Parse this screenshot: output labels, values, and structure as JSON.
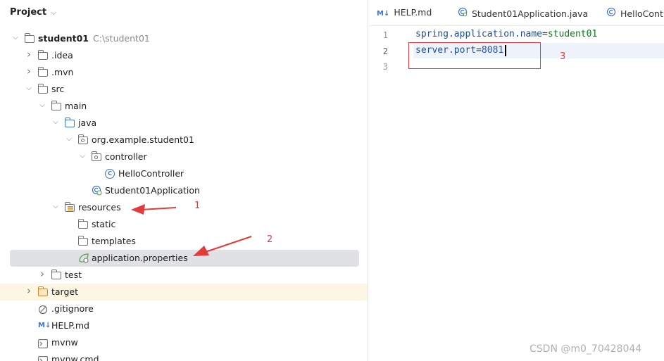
{
  "project": {
    "title": "Project",
    "tree": [
      {
        "label": "student01",
        "sublabel": "C:\\student01",
        "bold": true,
        "icon": "module-folder-icon",
        "arrow": "expanded"
      },
      {
        "label": ".idea",
        "icon": "folder-icon",
        "arrow": "collapsed"
      },
      {
        "label": ".mvn",
        "icon": "folder-icon",
        "arrow": "collapsed"
      },
      {
        "label": "src",
        "icon": "folder-icon",
        "arrow": "expanded"
      },
      {
        "label": "main",
        "icon": "folder-icon",
        "arrow": "expanded"
      },
      {
        "label": "java",
        "icon": "source-folder-icon",
        "arrow": "expanded"
      },
      {
        "label": "org.example.student01",
        "icon": "package-icon",
        "arrow": "expanded"
      },
      {
        "label": "controller",
        "icon": "package-icon",
        "arrow": "expanded"
      },
      {
        "label": "HelloController",
        "icon": "class-icon",
        "arrow": "none"
      },
      {
        "label": "Student01Application",
        "icon": "spring-class-icon",
        "arrow": "none"
      },
      {
        "label": "resources",
        "icon": "resources-folder-icon",
        "arrow": "expanded"
      },
      {
        "label": "static",
        "icon": "folder-icon",
        "arrow": "none"
      },
      {
        "label": "templates",
        "icon": "folder-icon",
        "arrow": "none"
      },
      {
        "label": "application.properties",
        "icon": "spring-properties-icon",
        "arrow": "none",
        "selected": true
      },
      {
        "label": "test",
        "icon": "folder-icon",
        "arrow": "collapsed"
      },
      {
        "label": "target",
        "icon": "excluded-folder-icon",
        "arrow": "collapsed",
        "highlighted": true
      },
      {
        "label": ".gitignore",
        "icon": "gitignore-icon",
        "arrow": "none"
      },
      {
        "label": "HELP.md",
        "icon": "markdown-icon",
        "arrow": "none"
      },
      {
        "label": "mvnw",
        "icon": "terminal-file-icon",
        "arrow": "none"
      },
      {
        "label": "mvnw.cmd",
        "icon": "terminal-file-icon",
        "arrow": "none"
      }
    ]
  },
  "tabs": [
    {
      "label": "HELP.md",
      "icon_text": "M↓",
      "icon": "markdown-icon"
    },
    {
      "label": "Student01Application.java",
      "icon_text": "",
      "icon": "spring-class-icon"
    },
    {
      "label": "HelloCont",
      "icon_text": "",
      "icon": "class-icon"
    }
  ],
  "editor": {
    "line_numbers": [
      "1",
      "2",
      "3"
    ],
    "lines": [
      {
        "key": "spring.application.name",
        "eq": "=",
        "value": "student01",
        "value_kind": "text"
      },
      {
        "key": "server.port",
        "eq": "=",
        "value": "8081",
        "value_kind": "number"
      },
      {
        "key": "",
        "eq": "",
        "value": "",
        "value_kind": "text"
      }
    ],
    "current_line": 2
  },
  "annotations": {
    "label_1": "1",
    "label_2": "2",
    "label_3": "3",
    "color": "#e23b3b"
  },
  "watermark": "CSDN @m0_70428044",
  "colors": {
    "accent": "#3d74d6",
    "selected_row": "#dfe1e5",
    "highlight_row": "#fdf6e3",
    "current_line": "#eef2fb"
  }
}
